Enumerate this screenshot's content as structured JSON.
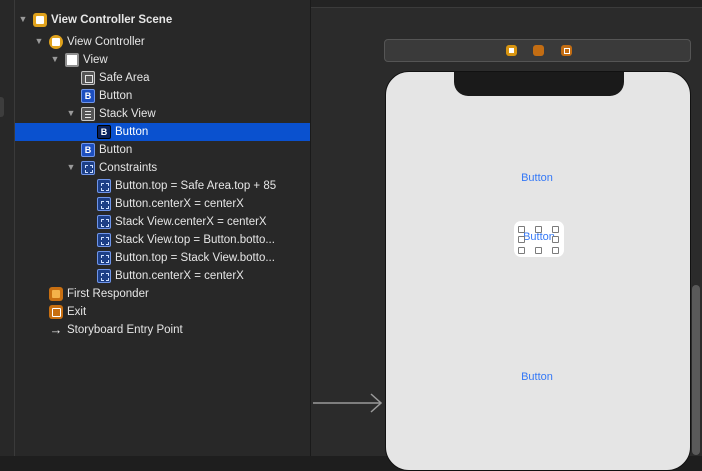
{
  "outline": {
    "items": [
      {
        "label": "View Controller Scene",
        "icon": "scene-icon",
        "expanded": true
      },
      {
        "label": "View Controller",
        "icon": "view-controller-icon",
        "expanded": true
      },
      {
        "label": "View",
        "icon": "view-icon",
        "expanded": true
      },
      {
        "label": "Safe Area",
        "icon": "safe-area-icon"
      },
      {
        "label": "Button",
        "icon": "button-icon"
      },
      {
        "label": "Stack View",
        "icon": "stack-view-icon",
        "expanded": true
      },
      {
        "label": "Button",
        "icon": "button-icon",
        "selected": true
      },
      {
        "label": "Button",
        "icon": "button-icon"
      },
      {
        "label": "Constraints",
        "icon": "constraints-icon",
        "expanded": true
      },
      {
        "label": "Button.top = Safe Area.top + 85",
        "icon": "constraint-icon"
      },
      {
        "label": "Button.centerX = centerX",
        "icon": "constraint-icon"
      },
      {
        "label": "Stack View.centerX = centerX",
        "icon": "constraint-icon"
      },
      {
        "label": "Stack View.top = Button.botto...",
        "icon": "constraint-icon"
      },
      {
        "label": "Button.top = Stack View.botto...",
        "icon": "constraint-icon"
      },
      {
        "label": "Button.centerX = centerX",
        "icon": "constraint-icon"
      },
      {
        "label": "First Responder",
        "icon": "first-responder-icon"
      },
      {
        "label": "Exit",
        "icon": "exit-icon"
      },
      {
        "label": "Storyboard Entry Point",
        "icon": "entry-point-arrow-icon"
      }
    ]
  },
  "canvas": {
    "dock_icons": [
      "view-controller-icon",
      "first-responder-icon",
      "exit-icon"
    ],
    "top_button_label": "Button",
    "stack_button_label": "Button",
    "bottom_button_label": "Button"
  },
  "colors": {
    "selection": "#0a51cf",
    "button_text": "#3478f6",
    "vc_icon": "#e0a21c"
  }
}
